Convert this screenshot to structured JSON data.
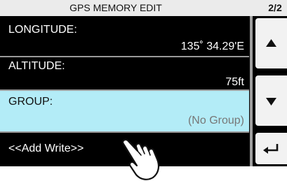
{
  "title": "GPS MEMORY EDIT",
  "page_indicator": "2/2",
  "rows": [
    {
      "label": "LONGITUDE:",
      "value": "135˚ 34.29'E"
    },
    {
      "label": "ALTITUDE:",
      "value": "75ft"
    },
    {
      "label": "GROUP:",
      "value": "(No Group)"
    },
    {
      "label": "<<Add Write>>"
    }
  ],
  "buttons": {
    "up": "up-arrow-icon",
    "down": "down-arrow-icon",
    "back": "return-arrow-icon"
  },
  "colors": {
    "screen_bg": "#000000",
    "selected_row": "#b3ecf7",
    "title_bar": "#ebebeb",
    "button_bg": "#f2f2f2"
  }
}
